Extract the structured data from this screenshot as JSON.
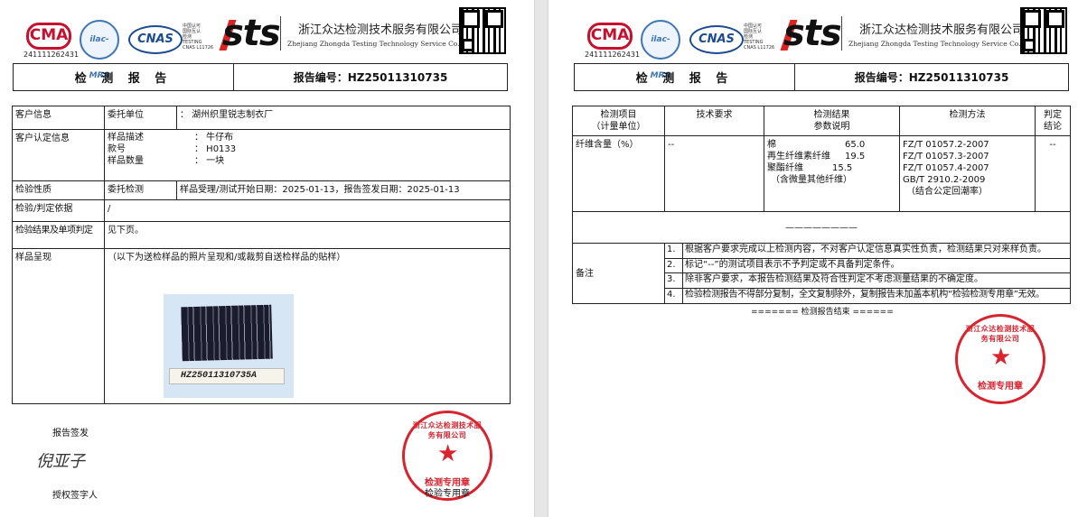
{
  "header": {
    "ma_logo": "CMA",
    "ma_number": "241111262431",
    "ilac_logo": "ilac-MRA",
    "cnas_logo": "CNAS",
    "cnas_text": [
      "中国认可",
      "国际互认",
      "检测",
      "TESTING",
      "CNAS L11726"
    ],
    "sts_logo": "sts",
    "company_cn": "浙江众达检测技术服务有限公司",
    "company_en": "Zhejiang Zhongda Testing Technology Service Co.,Ltd"
  },
  "title_bar": {
    "title": "检 测 报 告",
    "report_no": "报告编号：HZ25011310735"
  },
  "page1": {
    "client_label": "客户信息",
    "entrust_label": "委托单位",
    "entrust_value": "： 湖州织里锐志制衣厂",
    "client_ident_label": "客户认定信息",
    "sample_desc_label": "样品描述",
    "sample_desc_value": "： 牛仔布",
    "style_label": "款号",
    "style_value": "： H0133",
    "qty_label": "样品数量",
    "qty_value": "： 一块",
    "nature_label": "检验性质",
    "nature_value": "委托检测",
    "dates_value": "样品受理/测试开始日期：2025-01-13，报告签发日期：2025-01-13",
    "basis_label": "检验/判定依据",
    "basis_value": "/",
    "result_label": "检验结果及单项判定",
    "result_value": "见下页。",
    "sample_label": "样品呈现",
    "sample_note": "（以下为送检样品的照片呈现和/或裁剪自送检样品的贴样）",
    "sample_tag": "HZ25011310735A",
    "signer_title": "报告签发",
    "signature": "倪亚子",
    "auth_label": "授权签字人"
  },
  "page2": {
    "col_item": [
      "检测项目",
      "（计量单位）"
    ],
    "col_req": "技术要求",
    "col_result": [
      "检测结果",
      "参数说明"
    ],
    "col_method": "检测方法",
    "col_judge": [
      "判定",
      "结论"
    ],
    "row_item": "纤维含量（%）",
    "row_req": "--",
    "fibers": [
      {
        "name": "棉",
        "value": "65.0"
      },
      {
        "name": "再生纤维素纤维",
        "value": "19.5"
      },
      {
        "name": "聚酯纤维",
        "value": "15.5"
      }
    ],
    "fiber_note": "（含微量其他纤维）",
    "methods": [
      "FZ/T 01057.2-2007",
      "FZ/T 01057.3-2007",
      "FZ/T 01057.4-2007",
      "GB/T 2910.2-2009",
      "（结合公定回潮率）"
    ],
    "row_judge": "--",
    "blank_line": "————————",
    "remarks_label": "备注",
    "remarks": [
      {
        "n": "1.",
        "t": "根据客户要求完成以上检测内容，不对客户认定信息真实性负责，检测结果只对来样负责。"
      },
      {
        "n": "2.",
        "t": "标记“--”的测试项目表示不予判定或不具备判定条件。"
      },
      {
        "n": "3.",
        "t": "除非客户要求，本报告检测结果及符合性判定不考虑测量结果的不确定度。"
      },
      {
        "n": "4.",
        "t": "检验检测报告不得部分复制，全文复制除外，复制报告未加盖本机构“检验检测专用章”无效。"
      }
    ],
    "end_text": "======= 检测报告结束 ======"
  },
  "seal": {
    "arc_text": "浙江众达检测技术服务有限公司",
    "bottom_text": "检测专用章",
    "extra_text": "检验专用章"
  },
  "colors": {
    "seal_red": "#d9232e",
    "cma_red": "#c8102e",
    "cnas_blue": "#1b4c93"
  }
}
